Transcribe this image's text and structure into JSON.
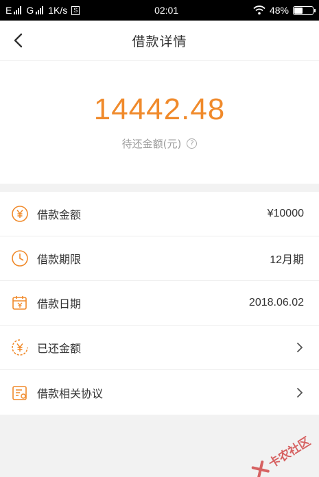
{
  "status_bar": {
    "network_1": "E",
    "network_2": "G",
    "speed": "1K/s",
    "badge": "S",
    "time": "02:01",
    "battery": "48%",
    "battery_level": 0.48
  },
  "header": {
    "title": "借款详情",
    "back_icon": "chevron-left-icon"
  },
  "summary": {
    "amount": "14442.48",
    "label": "待还金额(元)",
    "help_symbol": "?",
    "amount_color": "#f08a2b"
  },
  "details": [
    {
      "icon": "yuan-coin-icon",
      "label": "借款金额",
      "value": "¥10000",
      "has_arrow": false
    },
    {
      "icon": "clock-icon",
      "label": "借款期限",
      "value": "12月期",
      "has_arrow": false
    },
    {
      "icon": "calendar-icon",
      "label": "借款日期",
      "value": "2018.06.02",
      "has_arrow": false
    },
    {
      "icon": "repaid-coin-icon",
      "label": "已还金额",
      "value": "",
      "has_arrow": true
    },
    {
      "icon": "agreement-icon",
      "label": "借款相关协议",
      "value": "",
      "has_arrow": true
    }
  ],
  "watermark": {
    "text": "卡农社区"
  },
  "colors": {
    "accent": "#f08a2b",
    "watermark": "#d24a4a"
  }
}
